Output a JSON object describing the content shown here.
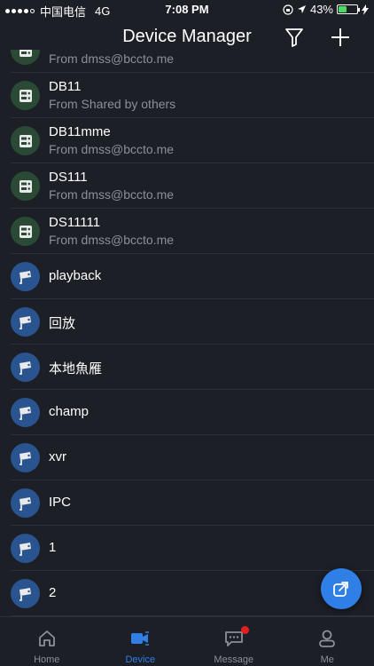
{
  "status_bar": {
    "carrier": "中国电信",
    "network": "4G",
    "time": "7:08 PM",
    "battery": "43%",
    "battery_level": 0.43
  },
  "header": {
    "title": "Device Manager"
  },
  "devices": [
    {
      "name": "",
      "sub": "From dmss@bccto.me",
      "icon": "dvr-icon",
      "kind": "green"
    },
    {
      "name": "DB11",
      "sub": "From Shared by others",
      "icon": "dvr-icon",
      "kind": "green"
    },
    {
      "name": "DB11mme",
      "sub": "From dmss@bccto.me",
      "icon": "dvr-icon",
      "kind": "green"
    },
    {
      "name": "DS111",
      "sub": "From dmss@bccto.me",
      "icon": "dvr-icon",
      "kind": "green"
    },
    {
      "name": "DS11111",
      "sub": "From dmss@bccto.me",
      "icon": "dvr-icon",
      "kind": "green"
    },
    {
      "name": "playback",
      "sub": "",
      "icon": "camera-icon",
      "kind": "blue"
    },
    {
      "name": "回放",
      "sub": "",
      "icon": "camera-icon",
      "kind": "blue"
    },
    {
      "name": "本地魚雁",
      "sub": "",
      "icon": "camera-icon",
      "kind": "blue"
    },
    {
      "name": "champ",
      "sub": "",
      "icon": "camera-icon",
      "kind": "blue"
    },
    {
      "name": "xvr",
      "sub": "",
      "icon": "camera-icon",
      "kind": "blue"
    },
    {
      "name": "IPC",
      "sub": "",
      "icon": "camera-icon",
      "kind": "blue"
    },
    {
      "name": "1",
      "sub": "",
      "icon": "camera-icon",
      "kind": "blue"
    },
    {
      "name": "2",
      "sub": "",
      "icon": "camera-icon",
      "kind": "blue"
    }
  ],
  "tabs": [
    {
      "label": "Home",
      "icon": "home-icon",
      "active": false
    },
    {
      "label": "Device",
      "icon": "device-camera-icon",
      "active": true
    },
    {
      "label": "Message",
      "icon": "message-icon",
      "active": false,
      "badge": true
    },
    {
      "label": "Me",
      "icon": "person-icon",
      "active": false
    }
  ],
  "colors": {
    "background": "#1c1f26",
    "accent": "#2f7fe6",
    "green_avatar": "#2a4a36",
    "blue_avatar": "#2a5490",
    "badge": "#e02020",
    "secondary_text": "#8b8f97"
  }
}
